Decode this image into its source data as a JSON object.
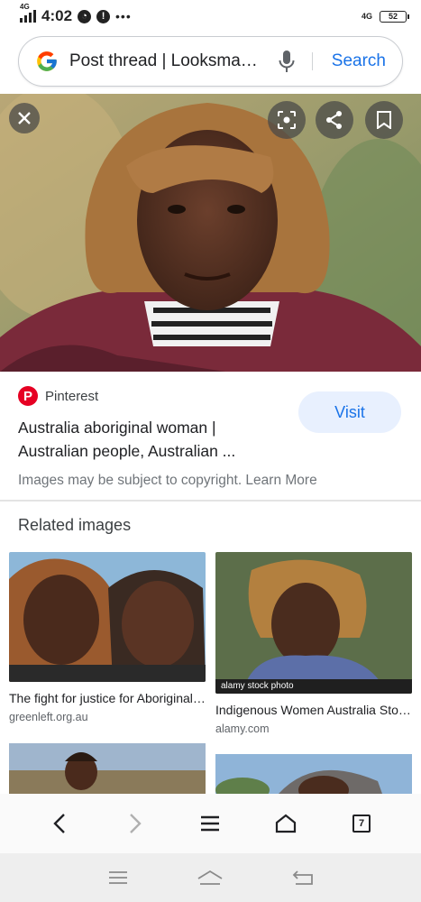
{
  "status_bar": {
    "network": "4G",
    "time": "4:02",
    "notification_icons": [
      "pie-icon",
      "alert-icon",
      "more-dots-icon"
    ],
    "right_network": "4G",
    "battery": "52"
  },
  "search": {
    "query": "Post thread | Looksmax....",
    "button_label": "Search"
  },
  "result": {
    "source": "Pinterest",
    "title": "Australia aboriginal woman | Australian people, Australian ...",
    "visit_label": "Visit",
    "copyright": "Images may be subject to copyright. Learn More"
  },
  "related": {
    "heading": "Related images",
    "items": [
      {
        "caption": "The fight for justice for Aboriginal women",
        "domain": "greenleft.org.au"
      },
      {
        "caption": "Indigenous Women Australia Stock Photos",
        "domain": "alamy.com",
        "watermark": "alamy stock photo"
      },
      {
        "caption": "",
        "domain": ""
      },
      {
        "caption": "",
        "domain": ""
      }
    ]
  },
  "browser_nav": {
    "tab_count": "7",
    "buttons": [
      "back-icon",
      "forward-icon",
      "menu-icon",
      "home-icon",
      "tabs-icon"
    ]
  },
  "system_nav": {
    "buttons": [
      "recents-icon",
      "home-icon",
      "back-icon"
    ]
  },
  "colors": {
    "accent": "#1a73e8",
    "visit_bg": "#e8f0fe",
    "pinterest": "#e60023"
  }
}
